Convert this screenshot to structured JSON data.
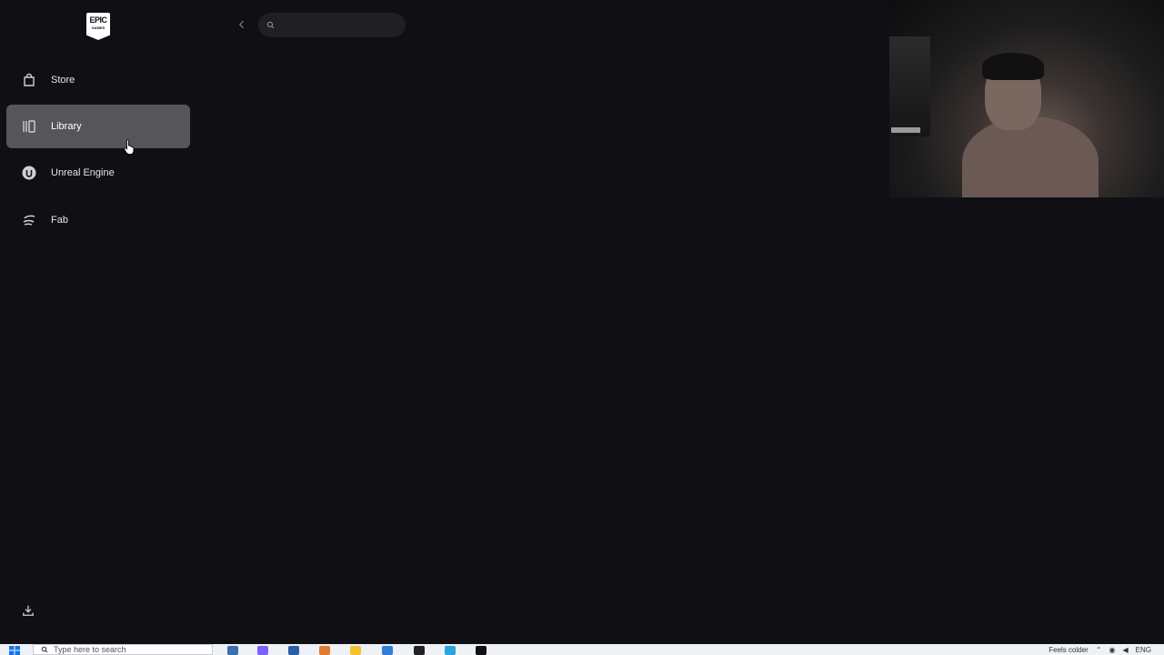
{
  "app": {
    "logo_text_top": "EPIC",
    "logo_text_bottom": "GAMES"
  },
  "sidebar": {
    "items": [
      {
        "label": "Store",
        "icon": "shopping-bag-icon",
        "active": false
      },
      {
        "label": "Library",
        "icon": "library-icon",
        "active": true
      },
      {
        "label": "Unreal Engine",
        "icon": "unreal-engine-icon",
        "active": false
      },
      {
        "label": "Fab",
        "icon": "fab-icon",
        "active": false
      }
    ],
    "download_icon": "download-icon"
  },
  "topbar": {
    "back_icon": "chevron-left-icon",
    "search_placeholder": "",
    "search_icon": "search-icon"
  },
  "taskbar": {
    "search_placeholder": "Type here to search",
    "weather_text": "Feels colder",
    "language": "ENG"
  },
  "colors": {
    "background": "#101014",
    "active_item": "#55555a",
    "search_bg": "#202024"
  }
}
